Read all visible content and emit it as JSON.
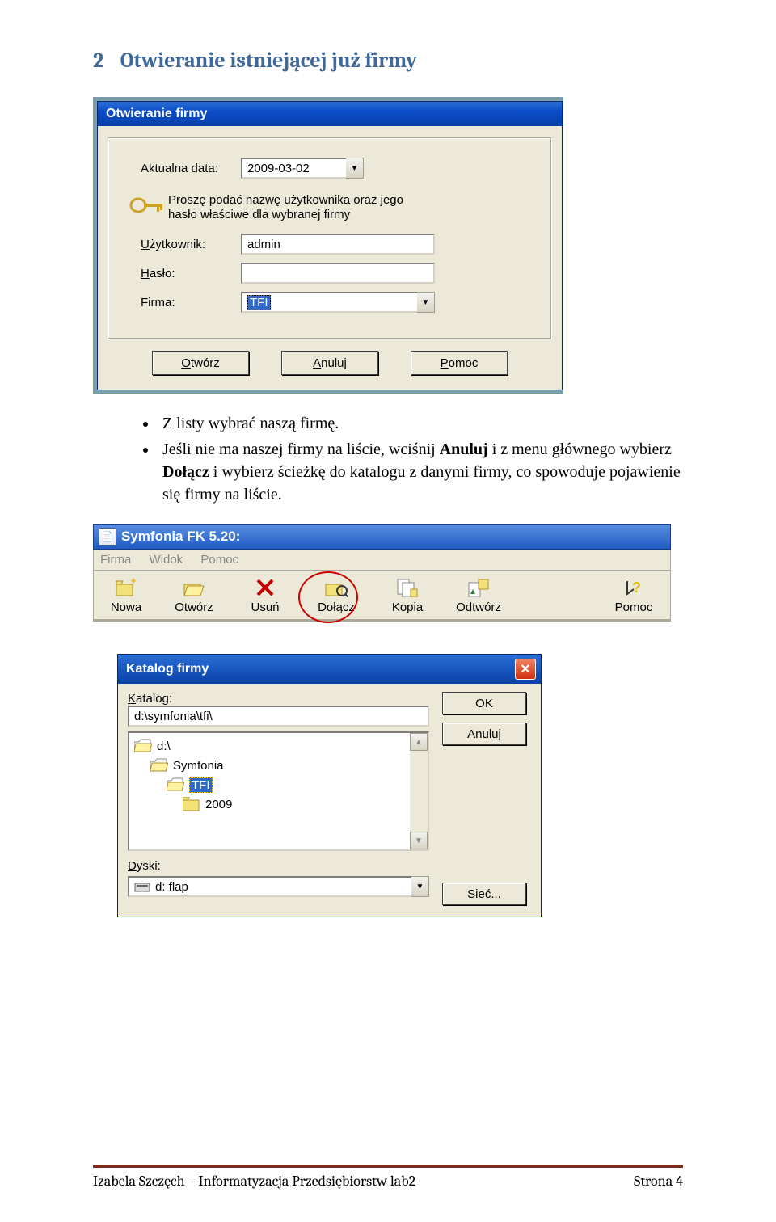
{
  "heading": {
    "num": "2",
    "text": "Otwieranie istniejącej już firmy"
  },
  "dialog1": {
    "title": "Otwieranie firmy",
    "date_label": "Aktualna data:",
    "date_value": "2009-03-02",
    "hint_line1": "Proszę podać nazwę użytkownika oraz jego",
    "hint_line2": "hasło właściwe dla wybranej firmy",
    "user_label_pre": "U",
    "user_label_rest": "żytkownik:",
    "user_value": "admin",
    "pass_label_pre": "H",
    "pass_label_rest": "asło:",
    "firm_label": "Firma:",
    "firm_value": "TFI",
    "btn_open_u": "O",
    "btn_open_rest": "twórz",
    "btn_cancel_u": "A",
    "btn_cancel_rest": "nuluj",
    "btn_help_u": "P",
    "btn_help_rest": "omoc"
  },
  "bullets": {
    "b1": "Z listy wybrać naszą firmę.",
    "b2_pre": "Jeśli nie ma naszej firmy na liście, wciśnij ",
    "b2_anuluj": "Anuluj",
    "b2_mid": " i z menu głównego wybierz ",
    "b2_dolacz": "Dołącz",
    "b2_end": " i wybierz ścieżkę do katalogu z danymi firmy, co spowoduje pojawienie się firmy na liście."
  },
  "symfonia": {
    "title": "Symfonia FK  5.20:",
    "menu": {
      "m1": "Firma",
      "m2": "Widok",
      "m3": "Pomoc"
    },
    "tb": {
      "nowa": "Nowa",
      "otworz": "Otwórz",
      "usun": "Usuń",
      "dolacz": "Dołącz",
      "kopia": "Kopia",
      "odtworz": "Odtwórz",
      "pomoc": "Pomoc"
    }
  },
  "katalog": {
    "title": "Katalog firmy",
    "katalog_label_pre": "K",
    "katalog_label_rest": "atalog:",
    "path": "d:\\symfonia\\tfi\\",
    "tree": {
      "d": "d:\\",
      "symfonia": "Symfonia",
      "tfi": "TFI",
      "y2009": "2009"
    },
    "dyski_label_pre": "D",
    "dyski_label_rest": "yski:",
    "drive": "d: flap",
    "ok": "OK",
    "anuluj": "Anuluj",
    "siec": "Sieć..."
  },
  "footer": {
    "left": "Izabela Szczęch – Informatyzacja Przedsiębiorstw  lab2",
    "right": "Strona 4"
  }
}
